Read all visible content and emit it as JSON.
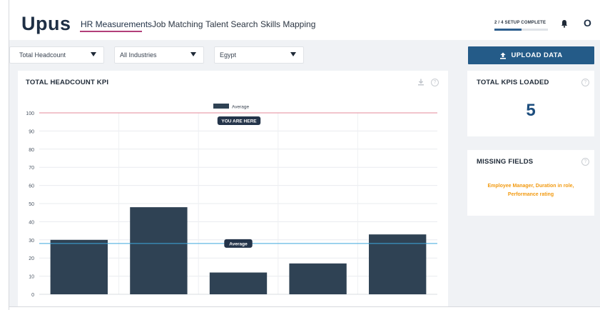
{
  "brand": {
    "logo_text": "Upus"
  },
  "nav": {
    "items": [
      {
        "label": "HR Measurements",
        "active": true
      },
      {
        "label": "Job Matching",
        "active": false
      },
      {
        "label": "Talent Search",
        "active": false
      },
      {
        "label": "Skills Mapping",
        "active": false
      }
    ]
  },
  "setup": {
    "text": "2 / 4 SETUP COMPLETE",
    "progress": 0.5
  },
  "user": {
    "avatar_initial": "O"
  },
  "filters": [
    {
      "value": "Total Headcount"
    },
    {
      "value": "All Industries"
    },
    {
      "value": "Egypt"
    }
  ],
  "upload_button": {
    "label": "UPLOAD DATA"
  },
  "chart_card": {
    "title": "TOTAL HEADCOUNT KPI"
  },
  "kpis_card": {
    "title": "TOTAL KPIS LOADED",
    "value": "5"
  },
  "missing_card": {
    "title": "MISSING FIELDS",
    "text_line1": "Employee Manager, Duration in role,",
    "text_line2": "Performance rating"
  },
  "chart_data": {
    "type": "bar",
    "categories": [
      "",
      "",
      "",
      "",
      ""
    ],
    "values": [
      30,
      48,
      12,
      17,
      33
    ],
    "ylim": [
      0,
      100
    ],
    "yticks": [
      0,
      10,
      20,
      30,
      40,
      50,
      60,
      70,
      80,
      90,
      100
    ],
    "grid": true,
    "legend": {
      "label": "Average",
      "position": "top-center"
    },
    "reference_lines": [
      {
        "name": "you-are-here",
        "value": 100,
        "label": "YOU ARE HERE",
        "color": "#e58a9a"
      },
      {
        "name": "average",
        "value": 28,
        "label": "Average",
        "color": "#3fa9dd"
      }
    ],
    "bar_color": "#2f4254"
  }
}
